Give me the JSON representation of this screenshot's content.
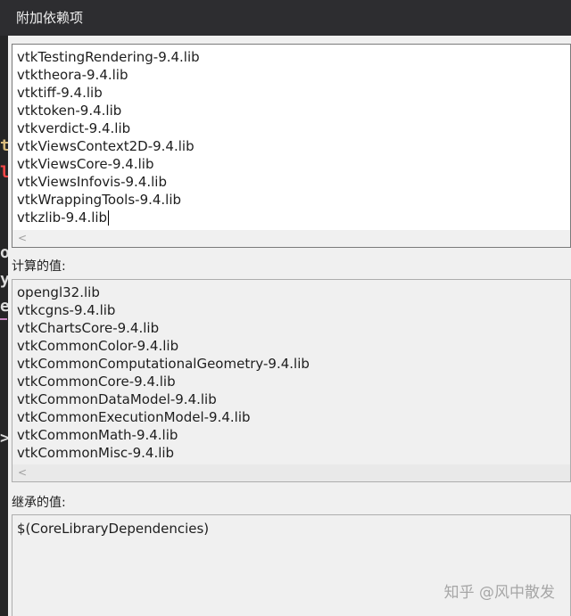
{
  "window": {
    "title": "附加依赖项"
  },
  "editable_list": {
    "items": [
      "vtkTestingRendering-9.4.lib",
      "vtktheora-9.4.lib",
      "vtktiff-9.4.lib",
      "vtktoken-9.4.lib",
      "vtkverdict-9.4.lib",
      "vtkViewsContext2D-9.4.lib",
      "vtkViewsCore-9.4.lib",
      "vtkViewsInfovis-9.4.lib",
      "vtkWrappingTools-9.4.lib",
      "vtkzlib-9.4.lib"
    ],
    "scroll_left_glyph": "<"
  },
  "computed_values": {
    "label": "计算的值:",
    "items": [
      "opengl32.lib",
      "vtkcgns-9.4.lib",
      "vtkChartsCore-9.4.lib",
      "vtkCommonColor-9.4.lib",
      "vtkCommonComputationalGeometry-9.4.lib",
      "vtkCommonCore-9.4.lib",
      "vtkCommonDataModel-9.4.lib",
      "vtkCommonExecutionModel-9.4.lib",
      "vtkCommonMath-9.4.lib",
      "vtkCommonMisc-9.4.lib"
    ],
    "scroll_left_glyph": "<"
  },
  "inherited_values": {
    "label": "继承的值:",
    "items": [
      "$(CoreLibraryDependencies)"
    ]
  },
  "background_strip": {
    "glyphs": [
      "t",
      "l",
      "o",
      "y",
      "e",
      ">"
    ]
  },
  "watermark": {
    "text": "知乎 @风中散发"
  }
}
